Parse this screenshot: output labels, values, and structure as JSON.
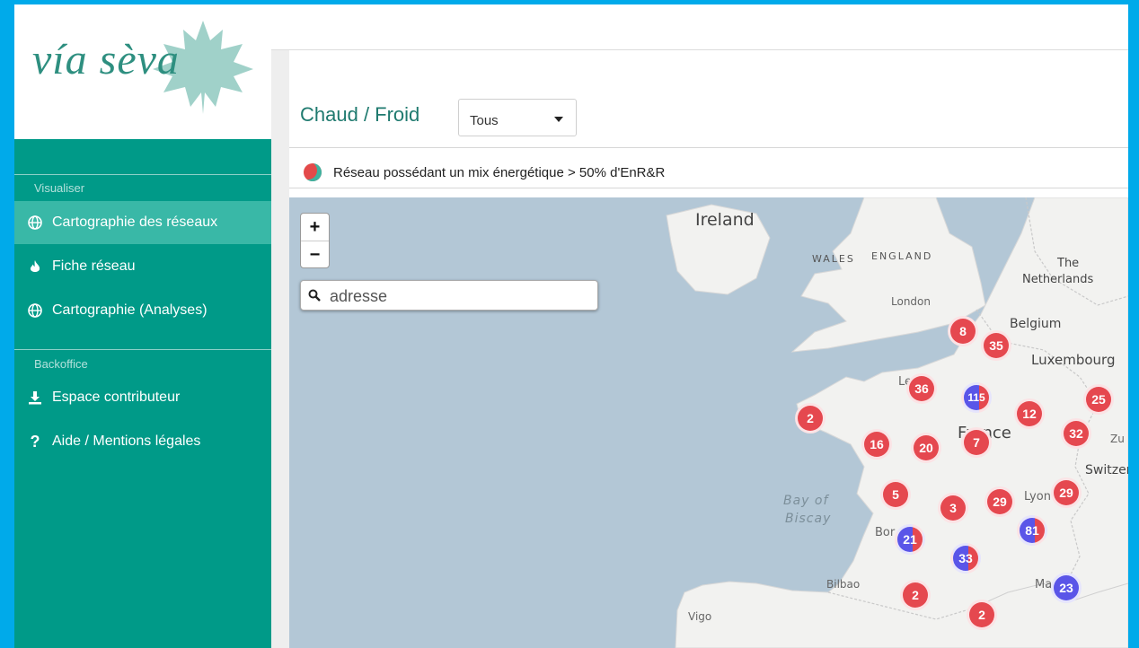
{
  "logo": {
    "text": "vía sèva"
  },
  "sidebar": {
    "sections": [
      {
        "label": "Visualiser"
      },
      {
        "label": "Backoffice"
      }
    ],
    "items": [
      {
        "label": "Cartographie des réseaux",
        "icon": "globe-icon",
        "active": true
      },
      {
        "label": "Fiche réseau",
        "icon": "flame-icon"
      },
      {
        "label": "Cartographie (Analyses)",
        "icon": "globe-icon"
      },
      {
        "label": "Espace contributeur",
        "icon": "download-icon"
      },
      {
        "label": "Aide / Mentions légales",
        "icon": "question-icon"
      }
    ]
  },
  "filter": {
    "title": "Chaud / Froid",
    "select_value": "Tous"
  },
  "legend": {
    "text": "Réseau possédant un mix énergétique > 50% d'EnR&R"
  },
  "map": {
    "zoom_in": "+",
    "zoom_out": "−",
    "search_placeholder": "adresse",
    "labels": {
      "ireland": "Ireland",
      "wales": "WALES",
      "england": "ENGLAND",
      "netherlands_1": "The",
      "netherlands_2": "Netherlands",
      "london": "London",
      "belgium": "Belgium",
      "luxembourg": "Luxembourg",
      "le": "Le",
      "france": "France",
      "zu": "Zu",
      "switzer": "Switzer",
      "bay_of": "Bay of",
      "biscay": "Biscay",
      "bordeaux": "Bor",
      "lyon": "Lyon",
      "bilbao": "Bilbao",
      "marseille": "Mar",
      "vigo": "Vigo"
    },
    "clusters": [
      {
        "count": "8",
        "type": "red"
      },
      {
        "count": "35",
        "type": "red"
      },
      {
        "count": "36",
        "type": "red"
      },
      {
        "count": "115",
        "type": "mixed"
      },
      {
        "count": "12",
        "type": "red"
      },
      {
        "count": "25",
        "type": "red"
      },
      {
        "count": "2",
        "type": "red"
      },
      {
        "count": "32",
        "type": "red"
      },
      {
        "count": "16",
        "type": "red"
      },
      {
        "count": "20",
        "type": "red"
      },
      {
        "count": "7",
        "type": "red"
      },
      {
        "count": "5",
        "type": "red"
      },
      {
        "count": "3",
        "type": "red"
      },
      {
        "count": "29",
        "type": "red"
      },
      {
        "count": "29",
        "type": "red"
      },
      {
        "count": "21",
        "type": "mixed"
      },
      {
        "count": "81",
        "type": "mixed"
      },
      {
        "count": "33",
        "type": "mixed"
      },
      {
        "count": "2",
        "type": "red"
      },
      {
        "count": "23",
        "type": "blue"
      },
      {
        "count": "2",
        "type": "red"
      }
    ]
  },
  "colors": {
    "sidebar": "#009a88",
    "sidebar_active": "#39b8a7",
    "frame": "#00aaea",
    "cluster_red": "#e5484f",
    "cluster_blue": "#5a55e8"
  }
}
